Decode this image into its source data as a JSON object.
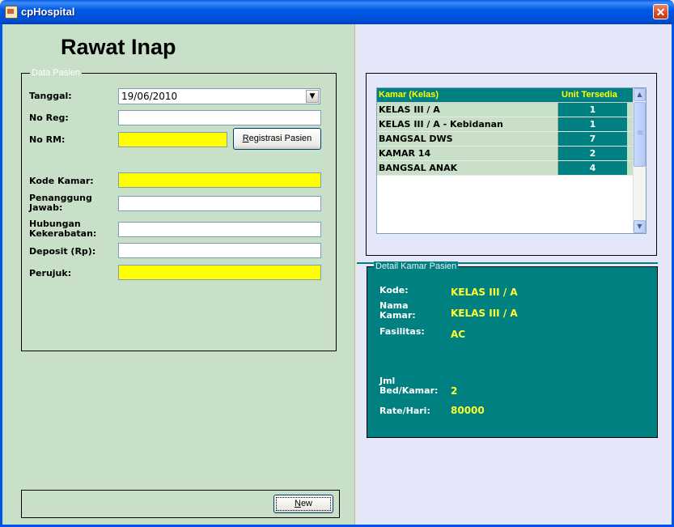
{
  "window": {
    "title": "cpHospital",
    "close_glyph": "✕"
  },
  "page_title": "Rawat Inap",
  "data_pasien": {
    "legend": "Data Pasien",
    "tanggal": {
      "label": "Tanggal:",
      "value": "19/06/2010"
    },
    "no_reg": {
      "label": "No Reg:",
      "value": ""
    },
    "no_rm": {
      "label": "No RM:",
      "value": ""
    },
    "registrasi_button": {
      "accel": "R",
      "rest": "egistrasi Pasien"
    },
    "kode_kamar": {
      "label": "Kode Kamar:",
      "value": ""
    },
    "penanggung_jawab": {
      "label_line1": "Penanggung",
      "label_line2": "Jawab:",
      "value": ""
    },
    "hubungan": {
      "label_line1": "Hubungan",
      "label_line2": "Kekerabatan:",
      "value": ""
    },
    "deposit": {
      "label": "Deposit (Rp):",
      "value": ""
    },
    "perujuk": {
      "label": "Perujuk:",
      "value": ""
    },
    "input_highlight_color": "#ffff00"
  },
  "new_button": {
    "accel": "N",
    "rest": "ew"
  },
  "kamar_grid": {
    "columns": [
      "Kamar (Kelas)",
      "Unit Tersedia"
    ],
    "rows": [
      {
        "kamar": "KELAS  III / A",
        "unit": "1"
      },
      {
        "kamar": "KELAS  III / A - Kebidanan",
        "unit": "1"
      },
      {
        "kamar": "BANGSAL DWS",
        "unit": "7"
      },
      {
        "kamar": "KAMAR 14",
        "unit": "2"
      },
      {
        "kamar": "BANGSAL ANAK",
        "unit": "4"
      }
    ],
    "header_color": "#008080",
    "header_text_color": "#ffff00"
  },
  "detail_kamar": {
    "legend": "Detail Kamar Pasien",
    "kode": {
      "label": "Kode:",
      "value": "KELAS  III / A"
    },
    "nama_kamar": {
      "label_line1": "Nama",
      "label_line2": "Kamar:",
      "value": "KELAS  III / A"
    },
    "fasilitas": {
      "label": "Fasilitas:",
      "value": "AC"
    },
    "jml_bed": {
      "label_line1": "Jml",
      "label_line2": "Bed/Kamar:",
      "value": "2"
    },
    "rate": {
      "label": "Rate/Hari:",
      "value": "80000"
    }
  },
  "colors": {
    "left_panel_bg": "#c8dfc8",
    "right_panel_bg": "#e3e7f9",
    "teal": "#008080",
    "value_yellow": "#ffff33"
  },
  "icons": [
    "app-icon",
    "close-icon",
    "dropdown-arrow-icon",
    "scroll-up-icon",
    "scroll-down-icon"
  ]
}
